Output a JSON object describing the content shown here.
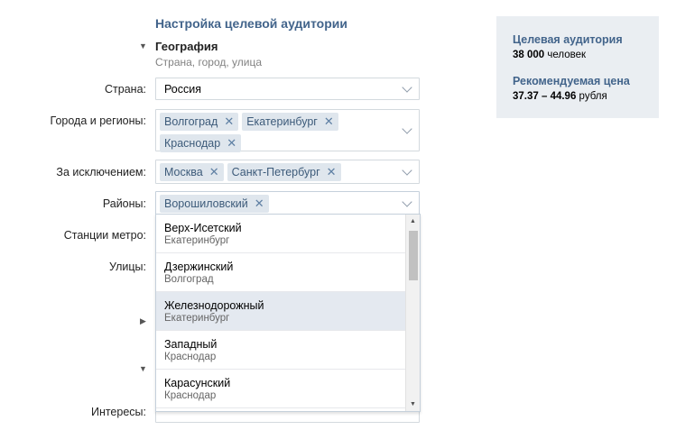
{
  "header": {
    "title": "Настройка целевой аудитории"
  },
  "geo": {
    "title": "География",
    "subtitle": "Страна, город, улица"
  },
  "fields": {
    "country": {
      "label": "Страна:",
      "value": "Россия"
    },
    "cities": {
      "label": "Города и регионы:",
      "tags": [
        "Волгоград",
        "Екатеринбург",
        "Краснодар"
      ]
    },
    "except": {
      "label": "За исключением:",
      "tags": [
        "Москва",
        "Санкт-Петербург"
      ]
    },
    "districts": {
      "label": "Районы:",
      "tags": [
        "Ворошиловский"
      ]
    },
    "metro": {
      "label": "Станции метро:"
    },
    "streets": {
      "label": "Улицы:"
    },
    "interests": {
      "label": "Интересы:"
    }
  },
  "dropdown": {
    "items": [
      {
        "name": "Верх-Исетский",
        "city": "Екатеринбург"
      },
      {
        "name": "Дзержинский",
        "city": "Волгоград"
      },
      {
        "name": "Железнодорожный",
        "city": "Екатеринбург",
        "highlighted": true
      },
      {
        "name": "Западный",
        "city": "Краснодар"
      },
      {
        "name": "Карасунский",
        "city": "Краснодар"
      }
    ]
  },
  "sidebar": {
    "audience_title": "Целевая аудитория",
    "audience_count": "38 000",
    "audience_unit": "человек",
    "price_title": "Рекомендуемая цена",
    "price_range": "37.37 – 44.96",
    "price_unit": "рубля"
  },
  "colors": {
    "accent": "#42648b",
    "tag_bg": "#dfe6ed",
    "highlight": "#e4e9f0",
    "panel_bg": "#eaeef2"
  }
}
